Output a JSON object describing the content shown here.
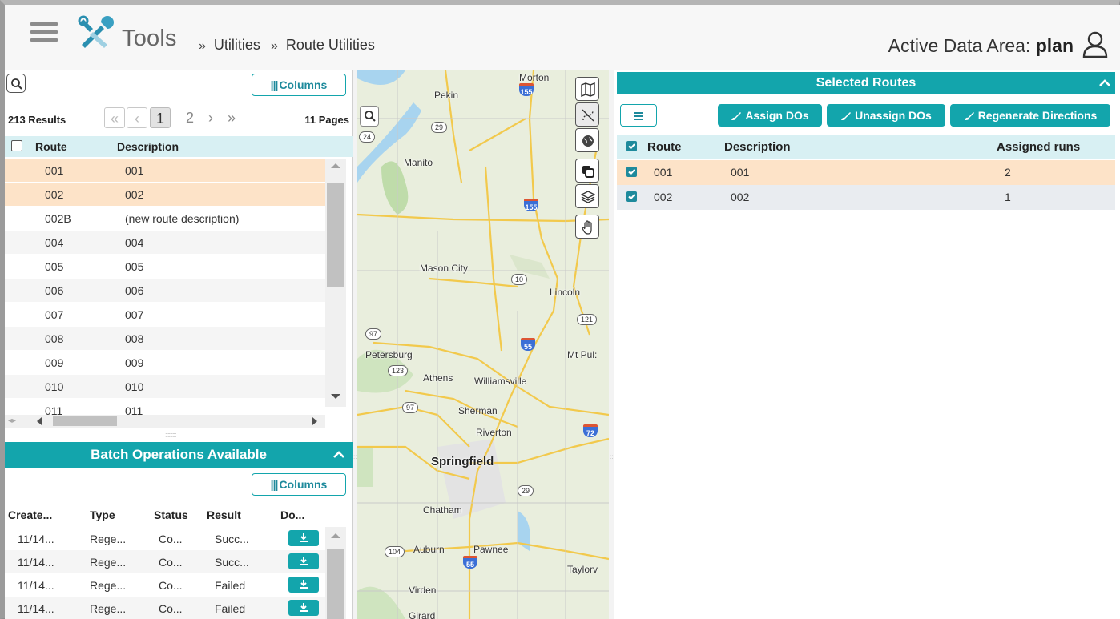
{
  "header": {
    "app_name": "Tools",
    "breadcrumb_sep": "»",
    "breadcrumbs": [
      "Utilities",
      "Route Utilities"
    ],
    "data_area_label": "Active Data Area:",
    "data_area_value": "plan"
  },
  "routes_grid": {
    "columns_button": "Columns",
    "results": "213 Results",
    "pages": "11 Pages",
    "pager": {
      "first": "«",
      "prev": "‹",
      "page1": "1",
      "page2": "2",
      "next": "›",
      "last": "»"
    },
    "columns": [
      "Route",
      "Description"
    ],
    "rows": [
      {
        "route": "001",
        "description": "001",
        "selected": true
      },
      {
        "route": "002",
        "description": "002",
        "selected": true
      },
      {
        "route": "002B",
        "description": "(new route description)",
        "selected": false
      },
      {
        "route": "004",
        "description": "004",
        "selected": false
      },
      {
        "route": "005",
        "description": "005",
        "selected": false
      },
      {
        "route": "006",
        "description": "006",
        "selected": false
      },
      {
        "route": "007",
        "description": "007",
        "selected": false
      },
      {
        "route": "008",
        "description": "008",
        "selected": false
      },
      {
        "route": "009",
        "description": "009",
        "selected": false
      },
      {
        "route": "010",
        "description": "010",
        "selected": false
      },
      {
        "route": "011",
        "description": "011",
        "selected": false
      }
    ]
  },
  "batch": {
    "title": "Batch Operations Available",
    "columns_button": "Columns",
    "columns": [
      "Create...",
      "Type",
      "Status",
      "Result",
      "Do..."
    ],
    "rows": [
      {
        "created": "11/14...",
        "type": "Rege...",
        "status": "Co...",
        "result": "Succ..."
      },
      {
        "created": "11/14...",
        "type": "Rege...",
        "status": "Co...",
        "result": "Succ..."
      },
      {
        "created": "11/14...",
        "type": "Rege...",
        "status": "Co...",
        "result": "Failed"
      },
      {
        "created": "11/14...",
        "type": "Rege...",
        "status": "Co...",
        "result": "Failed"
      }
    ]
  },
  "map": {
    "cities": {
      "morton": "Morton",
      "pekin": "Pekin",
      "manito": "Manito",
      "mason_city": "Mason City",
      "lincoln": "Lincoln",
      "petersburg": "Petersburg",
      "mt_pulaski": "Mt Pul:",
      "athens": "Athens",
      "williamsville": "Williamsville",
      "sherman": "Sherman",
      "riverton": "Riverton",
      "springfield": "Springfield",
      "chatham": "Chatham",
      "auburn": "Auburn",
      "pawnee": "Pawnee",
      "taylorville": "Taylorv",
      "virden": "Virden",
      "girard": "Girard"
    },
    "shields": {
      "i155a": "155",
      "i155b": "155",
      "i55a": "55",
      "i55b": "55",
      "i72": "72",
      "r29a": "29",
      "r29b": "29",
      "r10": "10",
      "r121": "121",
      "r97a": "97",
      "r97b": "97",
      "r123": "123",
      "r104": "104",
      "r24": "24"
    }
  },
  "selected_routes": {
    "title": "Selected Routes",
    "buttons": {
      "assign": "Assign DOs",
      "unassign": "Unassign DOs",
      "regenerate": "Regenerate Directions"
    },
    "columns": [
      "Route",
      "Description",
      "Assigned runs"
    ],
    "rows": [
      {
        "route": "001",
        "description": "001",
        "runs": "2"
      },
      {
        "route": "002",
        "description": "002",
        "runs": "1"
      }
    ]
  },
  "colors": {
    "accent": "#13a5ac",
    "selected_row": "#fde3c8",
    "header_bg": "#f7f7f7"
  }
}
